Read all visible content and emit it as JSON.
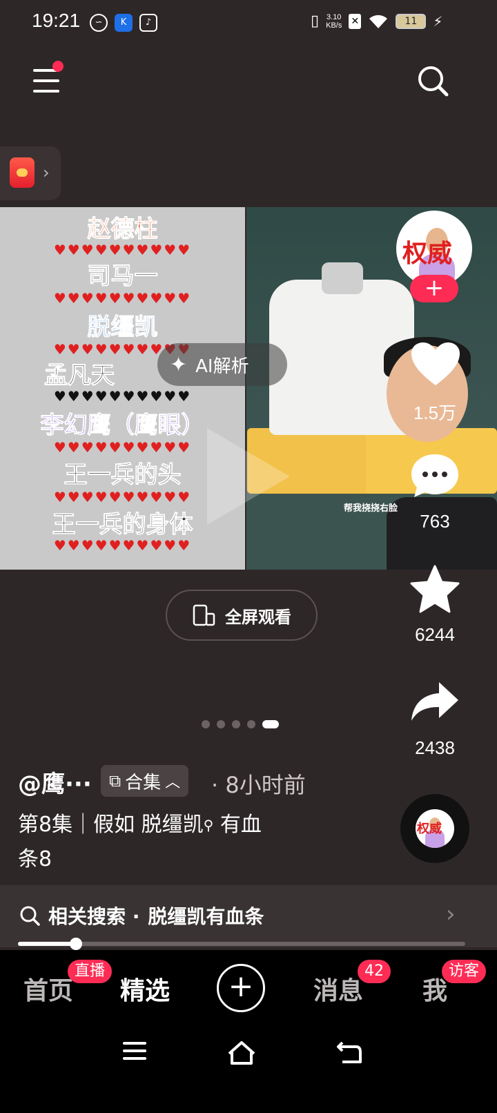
{
  "status_bar": {
    "time": "19:21",
    "apps": [
      "swirl-icon",
      "k-app-icon",
      "tiktok-icon"
    ],
    "net_speed_value": "3.10",
    "net_speed_unit": "KB/s",
    "battery": "11"
  },
  "video": {
    "left_labels": [
      "赵德柱",
      "司马一",
      "脱缰凯",
      "孟凡天",
      "李幻鹰（鹰眼）",
      "王一兵的头",
      "王一兵的身体"
    ],
    "left_label_colors": [
      "#f25a1e",
      "#5a5a5a",
      "#3a8de0",
      "#333333",
      "#8a4ae0",
      "#333333",
      "#333333"
    ],
    "in_video_caption": "帮我挠挠右脸",
    "ai_label": "AI解析"
  },
  "actions": {
    "avatar_text": "权威",
    "likes": "1.5万",
    "comments": "763",
    "favorites": "6244",
    "shares": "2438"
  },
  "fullscreen_label": "全屏观看",
  "carousel": {
    "count": 5,
    "active_index": 4
  },
  "post": {
    "author": "@鹰···",
    "collection_label": "合集",
    "time_ago": "· 8小时前",
    "description_line1": "第8集｜假如 脱缰凯",
    "description_line1_tail": "有血",
    "description_line2": "条8"
  },
  "related": {
    "prefix": "相关搜索 ·",
    "query": "脱缰凯有血条"
  },
  "progress": 0.13,
  "tabs": {
    "home": "首页",
    "home_badge": "直播",
    "featured": "精选",
    "messages": "消息",
    "messages_badge": "42",
    "me": "我",
    "me_badge": "访客"
  },
  "colors": {
    "background": "#2e2728",
    "accent": "#fe2c55",
    "tabbar": "#000000"
  }
}
